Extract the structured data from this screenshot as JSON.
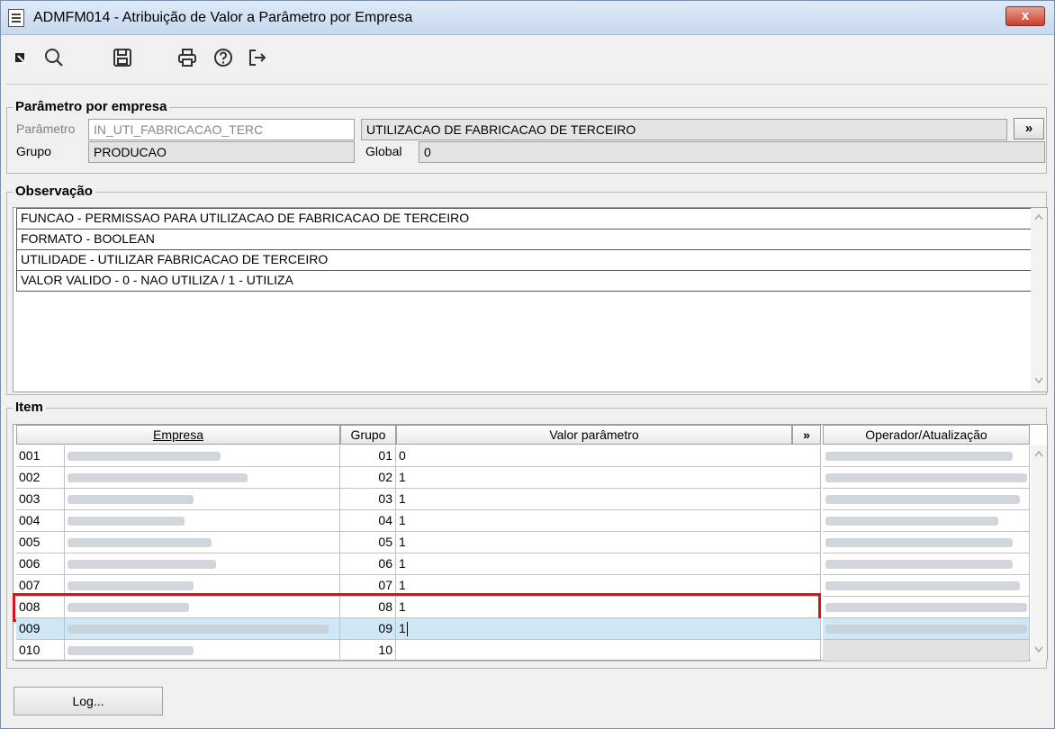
{
  "window": {
    "title": "ADMFM014 - Atribuição de Valor a Parâmetro por Empresa",
    "close": "x"
  },
  "toolbar": {
    "icons": [
      "select-arrow-icon",
      "search-icon",
      "save-icon",
      "print-icon",
      "help-icon",
      "exit-icon"
    ]
  },
  "parametro": {
    "legend": "Parâmetro por empresa",
    "parametro_label": "Parâmetro",
    "parametro_value": "IN_UTI_FABRICACAO_TERC",
    "descricao_value": "UTILIZACAO DE FABRICACAO DE TERCEIRO",
    "more_button": "»",
    "grupo_label": "Grupo",
    "grupo_value": "PRODUCAO",
    "global_label": "Global",
    "global_value": "0"
  },
  "observacao": {
    "legend": "Observação",
    "lines": [
      "FUNCAO - PERMISSAO PARA UTILIZACAO DE FABRICACAO DE TERCEIRO",
      "FORMATO - BOOLEAN",
      "UTILIDADE - UTILIZAR FABRICACAO DE TERCEIRO",
      "VALOR VALIDO - 0 - NAO UTILIZA / 1 - UTILIZA"
    ]
  },
  "item": {
    "legend": "Item",
    "columns": {
      "empresa": "Empresa",
      "grupo": "Grupo",
      "valor": "Valor parâmetro",
      "more": "»",
      "operador": "Operador/Atualização"
    },
    "rows": [
      {
        "num": "001",
        "grupo": "01",
        "valor": "0"
      },
      {
        "num": "002",
        "grupo": "02",
        "valor": "1"
      },
      {
        "num": "003",
        "grupo": "03",
        "valor": "1"
      },
      {
        "num": "004",
        "grupo": "04",
        "valor": "1"
      },
      {
        "num": "005",
        "grupo": "05",
        "valor": "1"
      },
      {
        "num": "006",
        "grupo": "06",
        "valor": "1"
      },
      {
        "num": "007",
        "grupo": "07",
        "valor": "1"
      },
      {
        "num": "008",
        "grupo": "08",
        "valor": "1"
      },
      {
        "num": "009",
        "grupo": "09",
        "valor": "1"
      },
      {
        "num": "010",
        "grupo": "10",
        "valor": ""
      }
    ],
    "highlighted_row": "008",
    "selected_row": "009"
  },
  "footer": {
    "log_button": "Log..."
  },
  "colors": {
    "highlight": "#d8151b",
    "selected": "#cfe8f7"
  }
}
